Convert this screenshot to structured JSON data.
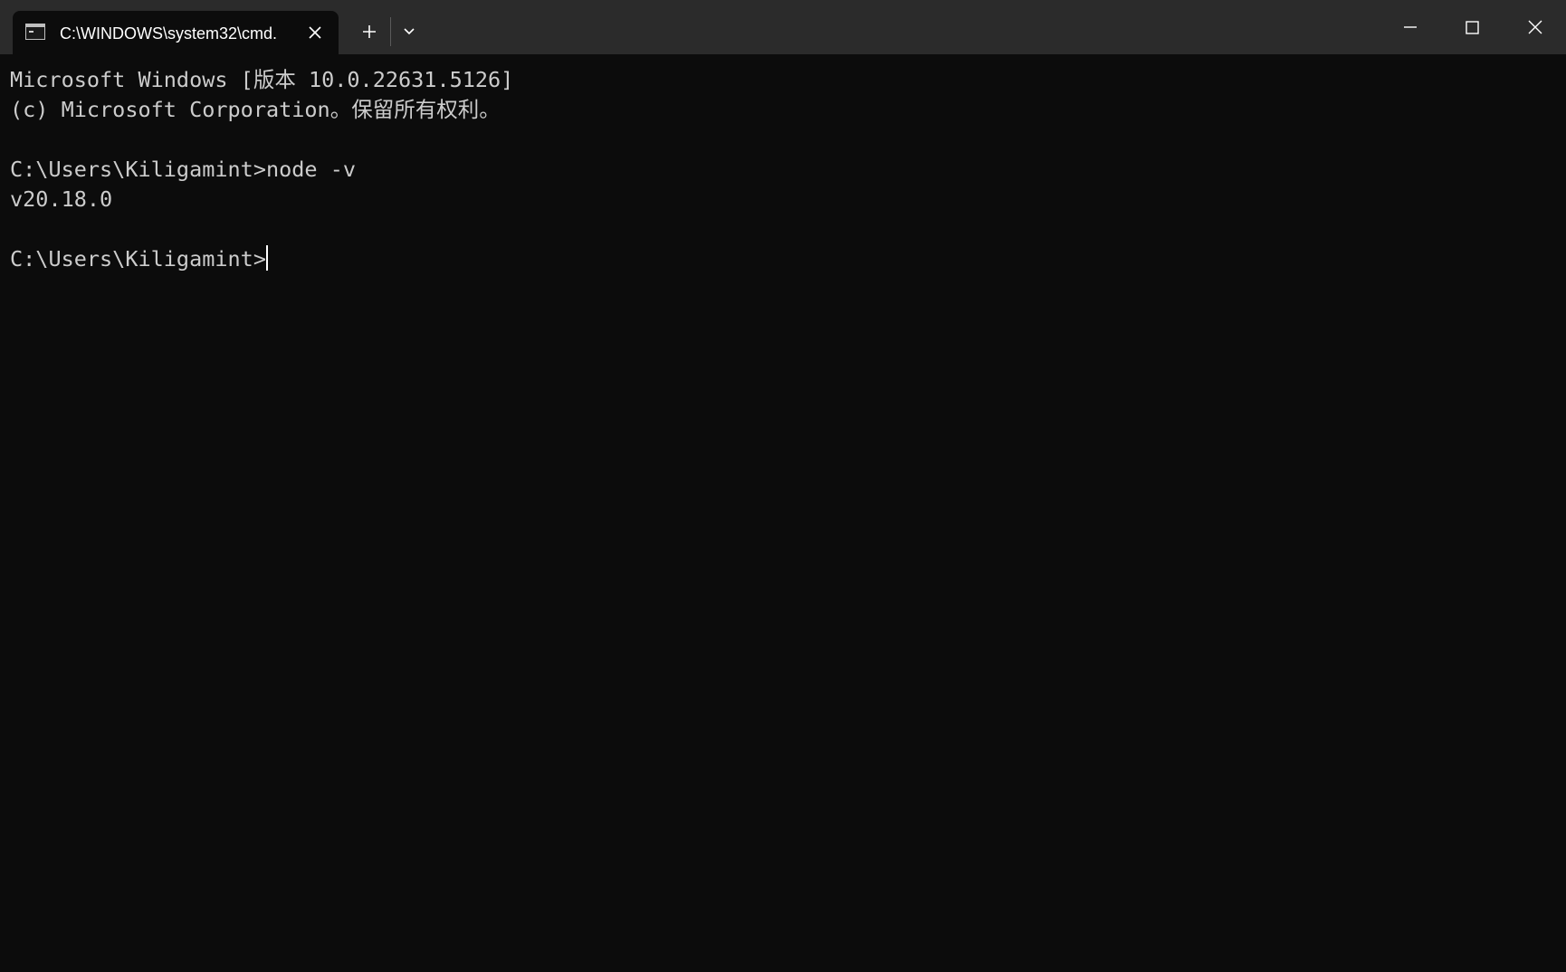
{
  "window": {
    "tab_title": "C:\\WINDOWS\\system32\\cmd.",
    "icons": {
      "tab": "command-prompt-icon",
      "tab_close": "close-icon",
      "new_tab": "plus-icon",
      "dropdown": "chevron-down-icon",
      "minimize": "minimize-icon",
      "maximize": "maximize-icon",
      "close": "close-icon"
    }
  },
  "terminal": {
    "lines": [
      "Microsoft Windows [版本 10.0.22631.5126]",
      "(c) Microsoft Corporation。保留所有权利。",
      "",
      "C:\\Users\\Kiligamint>node -v",
      "v20.18.0",
      "",
      "C:\\Users\\Kiligamint>"
    ]
  },
  "colors": {
    "titlebar": "#2b2b2b",
    "background": "#0c0c0c",
    "text": "#cccccc"
  }
}
